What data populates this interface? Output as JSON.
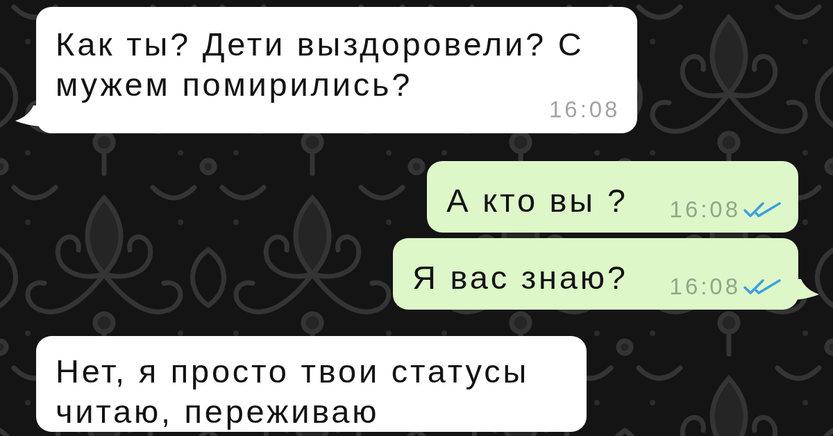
{
  "messages": [
    {
      "kind": "incoming",
      "text": "Как ты? Дети выздоровели? С мужем помирились?",
      "time": "16:08",
      "tail": true
    },
    {
      "kind": "outgoing",
      "text": "А кто вы ?",
      "time": "16:08",
      "read": true,
      "tail": false
    },
    {
      "kind": "outgoing",
      "text": "Я вас знаю?",
      "time": "16:08",
      "read": true,
      "tail": true
    },
    {
      "kind": "incoming",
      "text": "Нет, я просто твои статусы читаю, переживаю",
      "tail": false
    }
  ]
}
